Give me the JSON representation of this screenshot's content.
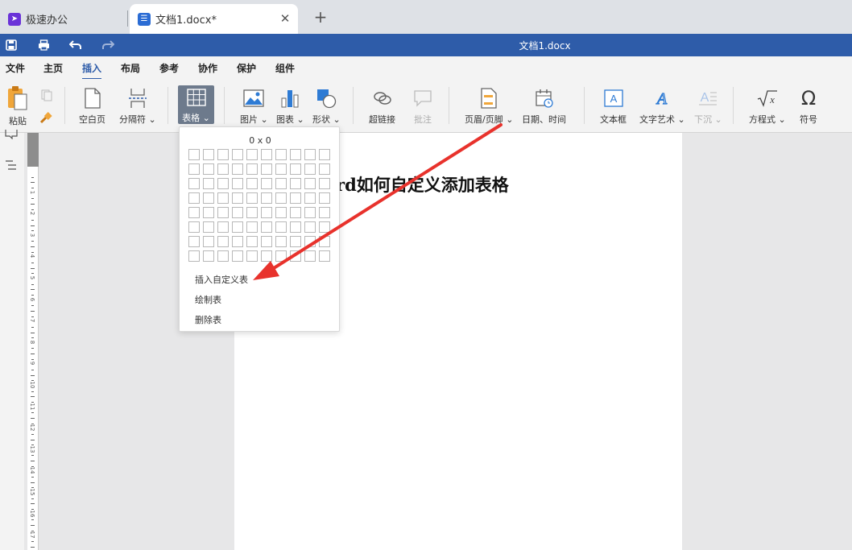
{
  "tabs": [
    {
      "label": "极速办公",
      "icon": "rocket-icon"
    },
    {
      "label": "文档1.docx*",
      "icon": "document-icon",
      "active": true
    }
  ],
  "titlebar": {
    "title": "文档1.docx",
    "bg": "#2e5ca9"
  },
  "menu": [
    "文件",
    "主页",
    "插入",
    "布局",
    "参考",
    "协作",
    "保护",
    "组件"
  ],
  "ribbon": {
    "paste": "粘贴",
    "blank_page": "空白页",
    "separator": "分隔符",
    "table": "表格",
    "image": "图片",
    "chart": "图表",
    "shape": "形状",
    "hyperlink": "超链接",
    "comment": "批注",
    "header_footer": "页眉/页脚",
    "datetime": "日期、时间",
    "textbox": "文本框",
    "wordart": "文字艺术",
    "dropcap": "下沉",
    "equation": "方程式",
    "symbol": "符号"
  },
  "document": {
    "heading": "rd如何自定义添加表格"
  },
  "table_menu": {
    "grid_label": "0 x 0",
    "insert_custom": "插入自定义表",
    "draw_table": "绘制表",
    "delete_table": "删除表"
  },
  "ruler_numbers": [
    "1",
    "2",
    "3",
    "4",
    "5",
    "6",
    "7",
    "8",
    "9",
    "10",
    "11",
    "12",
    "13",
    "14",
    "15",
    "16",
    "17"
  ],
  "accent": "#2e5ca9",
  "arrow_color": "#e8322c"
}
